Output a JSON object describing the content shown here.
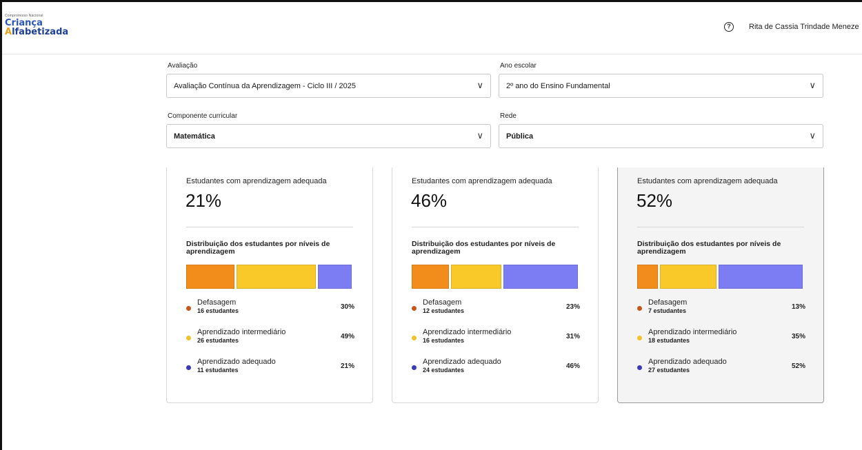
{
  "header": {
    "logo_small": "Compromisso Nacional",
    "logo_line1": "Criança",
    "logo_line2_initial": "A",
    "logo_line2_rest": "lfabetizada",
    "help_icon": "question-circle-icon",
    "user_name": "Rita de Cassia Trindade Meneze"
  },
  "filters": {
    "avaliacao": {
      "label": "Avaliação",
      "value": "Avaliação Contínua da Aprendizagem - Ciclo III / 2025"
    },
    "ano_escolar": {
      "label": "Ano escolar",
      "value": "2º ano do Ensino Fundamental"
    },
    "componente": {
      "label": "Componente curricular",
      "value": "Matemática"
    },
    "rede": {
      "label": "Rede",
      "value": "Pública"
    },
    "chevron": "∨"
  },
  "cards": [
    {
      "title": "Estudantes com aprendizagem adequada",
      "percentage": "21%",
      "dist_title": "Distribuição dos estudantes por níveis de aprendizagem",
      "bar_fractions": [
        0.3,
        0.49,
        0.21
      ],
      "levels": [
        {
          "name": "Defasagem",
          "count": "16 estudantes",
          "pct": "30%",
          "color": "#c8561b"
        },
        {
          "name": "Aprendizado intermediário",
          "count": "26 estudantes",
          "pct": "49%",
          "color": "#f1c22a"
        },
        {
          "name": "Aprendizado adequado",
          "count": "11 estudantes",
          "pct": "21%",
          "color": "#3a3ab8"
        }
      ]
    },
    {
      "title": "Estudantes com aprendizagem adequada",
      "percentage": "46%",
      "dist_title": "Distribuição dos estudantes por níveis de aprendizagem",
      "bar_fractions": [
        0.23,
        0.31,
        0.46
      ],
      "levels": [
        {
          "name": "Defasagem",
          "count": "12 estudantes",
          "pct": "23%",
          "color": "#c8561b"
        },
        {
          "name": "Aprendizado intermediário",
          "count": "16 estudantes",
          "pct": "31%",
          "color": "#f1c22a"
        },
        {
          "name": "Aprendizado adequado",
          "count": "24 estudantes",
          "pct": "46%",
          "color": "#3a3ab8"
        }
      ]
    },
    {
      "title": "Estudantes com aprendizagem adequada",
      "percentage": "52%",
      "dist_title": "Distribuição dos estudantes por níveis de aprendizagem",
      "bar_fractions": [
        0.13,
        0.35,
        0.52
      ],
      "levels": [
        {
          "name": "Defasagem",
          "count": "7 estudantes",
          "pct": "13%",
          "color": "#c8561b"
        },
        {
          "name": "Aprendizado intermediário",
          "count": "18 estudantes",
          "pct": "35%",
          "color": "#f1c22a"
        },
        {
          "name": "Aprendizado adequado",
          "count": "27 estudantes",
          "pct": "52%",
          "color": "#3a3ab8"
        }
      ]
    }
  ],
  "colors": {
    "orange": "#f28c1a",
    "yellow": "#f8c928",
    "blue": "#7d7df3"
  }
}
